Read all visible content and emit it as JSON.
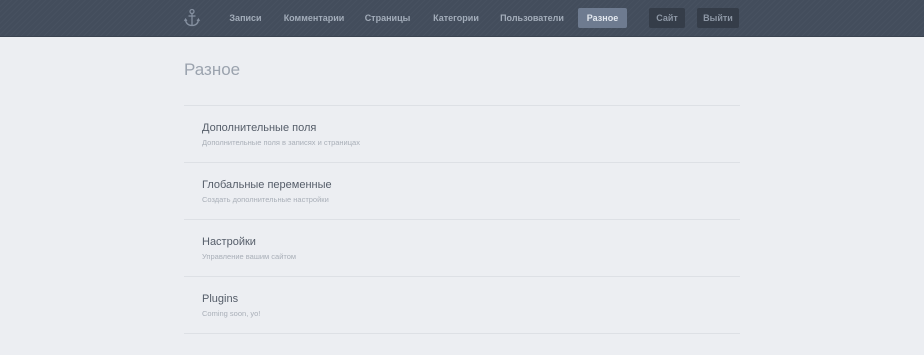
{
  "nav": {
    "logo_icon": "anchor-icon",
    "items": [
      {
        "label": "Записи",
        "active": false
      },
      {
        "label": "Комментарии",
        "active": false
      },
      {
        "label": "Страницы",
        "active": false
      },
      {
        "label": "Категории",
        "active": false
      },
      {
        "label": "Пользователи",
        "active": false
      },
      {
        "label": "Разное",
        "active": true
      }
    ],
    "site_label": "Сайт",
    "logout_label": "Выйти"
  },
  "page": {
    "title": "Разное",
    "items": [
      {
        "title": "Дополнительные поля",
        "description": "Дополнительные поля в записях и страницах"
      },
      {
        "title": "Глобальные переменные",
        "description": "Создать дополнительные настройки"
      },
      {
        "title": "Настройки",
        "description": "Управление вашим сайтом"
      },
      {
        "title": "Plugins",
        "description": "Coming soon, yo!"
      }
    ]
  },
  "colors": {
    "topbar": "#434d5c",
    "active_tab": "#6e7b90",
    "background": "#eceef2"
  }
}
